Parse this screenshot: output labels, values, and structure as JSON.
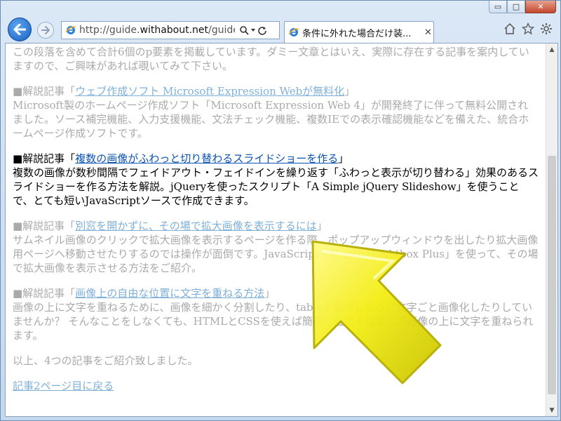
{
  "window": {
    "caption_buttons": {
      "minimize": "▭",
      "maximize": "□",
      "close": "✕"
    }
  },
  "navbar": {
    "address": {
      "prefix": "http://guide.",
      "domain": "withabout.net",
      "suffix": "/guide/g"
    },
    "tab_title": "条件に外れた場合だけ装...",
    "tab_close": "✕",
    "icons": [
      "home-icon",
      "favorites-star-icon",
      "settings-gear-icon"
    ]
  },
  "content": {
    "p1": "この段落を含めて合計6個のp要素を掲載しています。ダミー文章とはいえ、実際に存在する記事を案内していますので、ご興味があれば覗いてみて下さい。",
    "articles": [
      {
        "prefix": "■解説記事「",
        "link": "ウェブ作成ソフト Microsoft Expression Webが無料化",
        "suffix": "」",
        "body": "Microsoft製のホームページ作成ソフト「Microsoft Expression Web 4」が開発終了に伴って無料公開されました。ソース補完機能、入力支援機能、文法チェック機能、複数IEでの表示確認機能などを備えた、統合ホームページ作成ソフトです。"
      },
      {
        "prefix": "■解説記事「",
        "link": "複数の画像がふわっと切り替わるスライドショーを作る",
        "suffix": "」",
        "body": "複数の画像が数秒間隔でフェイドアウト・フェイドインを繰り返す「ふわっと表示が切り替わる」効果のあるスライドショーを作る方法を解説。jQueryを使ったスクリプト「A Simple jQuery Slideshow」を使うことで、とても短いJavaScriptソースで作成できます。"
      },
      {
        "prefix": "■解説記事「",
        "link": "別窓を開かずに、その場で拡大画像を表示するには",
        "suffix": "」",
        "body": "サムネイル画像のクリックで拡大画像を表示するページを作る際、ポップアップウィンドウを出したり拡大画像用ページへ移動させたりするのでは操作が面倒です。JavaScriptを使った「Lightbox Plus」を使って、その場で拡大画像を表示させる方法をご紹介。"
      },
      {
        "prefix": "■解説記事「",
        "link": "画像上の自由な位置に文字を重ねる方法",
        "suffix": "」",
        "body": "画像の上に文字を重ねるために、画像を細かく分割したり、tableを駆使したり、文字ごと画像化したりしていませんか？ そんなことをしなくても、HTMLとCSSを使えば簡単に位置を指定して画像の上に文字を重ねられます。"
      }
    ],
    "p6": "以上、4つの記事をご紹介致しました。",
    "back_link": "記事2ページ目に戻る"
  },
  "colors": {
    "faded_text": "#aaaaaa",
    "faded_link": "#7fb0d9",
    "active_text": "#000000",
    "active_link": "#0b53b2",
    "arrow_yellow": "#f2ec1a"
  }
}
